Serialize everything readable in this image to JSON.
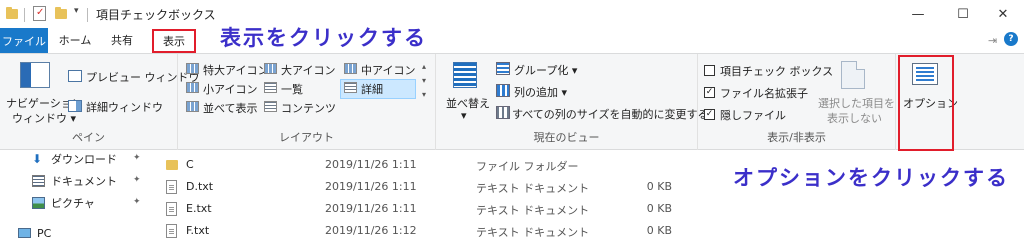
{
  "window": {
    "title": "項目チェックボックス",
    "controls": {
      "minimize": "—",
      "maximize": "☐",
      "close": "✕"
    }
  },
  "tabs": [
    {
      "label": "ファイル"
    },
    {
      "label": "ホーム"
    },
    {
      "label": "共有"
    },
    {
      "label": "表示"
    }
  ],
  "annotations": {
    "top": "表示をクリックする",
    "bottom": "オプションをクリックする"
  },
  "ribbon": {
    "pane": {
      "nav_pane_line1": "ナビゲーション",
      "nav_pane_line2": "ウィンドウ ▾",
      "preview": "プレビュー ウィンドウ",
      "details": "詳細ウィンドウ",
      "label": "ペイン"
    },
    "layout": {
      "items": [
        "特大アイコン",
        "大アイコン",
        "中アイコン",
        "小アイコン",
        "一覧",
        "詳細",
        "並べて表示",
        "コンテンツ"
      ],
      "label": "レイアウト"
    },
    "current_view": {
      "sort_line1": "並べ替え",
      "sort_line2": "▾",
      "group_by": "グループ化 ▾",
      "add_columns": "列の追加 ▾",
      "fit_columns": "すべての列のサイズを自動的に変更する",
      "label": "現在のビュー"
    },
    "show_hide": {
      "item_checkboxes": "項目チェック ボックス",
      "item_checkboxes_checked": false,
      "file_extensions": "ファイル名拡張子",
      "file_extensions_checked": true,
      "hidden_items": "隠しファイル",
      "hidden_items_checked": true,
      "hide_selected_line1": "選択した項目を",
      "hide_selected_line2": "表示しない",
      "label": "表示/非表示"
    },
    "options": {
      "label": "オプション"
    }
  },
  "nav": [
    {
      "label": "ダウンロード",
      "pinned": true
    },
    {
      "label": "ドキュメント",
      "pinned": true
    },
    {
      "label": "ピクチャ",
      "pinned": true
    },
    {
      "label": "PC",
      "pinned": false
    }
  ],
  "files": [
    {
      "name": "C",
      "date": "2019/11/26 1:11",
      "type": "ファイル フォルダー",
      "size": ""
    },
    {
      "name": "D.txt",
      "date": "2019/11/26 1:11",
      "type": "テキスト ドキュメント",
      "size": "0 KB"
    },
    {
      "name": "E.txt",
      "date": "2019/11/26 1:11",
      "type": "テキスト ドキュメント",
      "size": "0 KB"
    },
    {
      "name": "F.txt",
      "date": "2019/11/26 1:12",
      "type": "テキスト ドキュメント",
      "size": "0 KB"
    }
  ],
  "colors": {
    "file_tab": "#1979ca",
    "annotation_text": "#3b2fc9",
    "highlight_box": "#e11d2b",
    "selected_layout": "#cce8ff"
  }
}
